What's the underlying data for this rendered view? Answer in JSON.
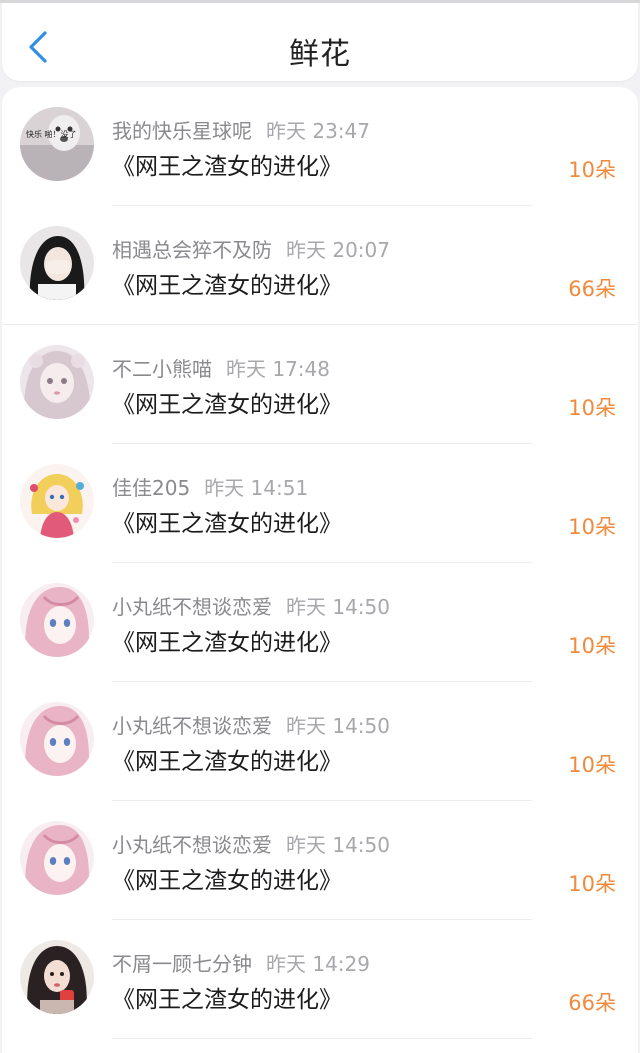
{
  "header": {
    "title": "鲜花",
    "back_icon": "chevron-left-icon",
    "back_color": "#2f8fe6"
  },
  "accent_color": "#f08a3c",
  "items": [
    {
      "user": "我的快乐星球呢",
      "time": "昨天 23:47",
      "book": "《网王之渣女的进化》",
      "amount": "10朵",
      "avatar_text": "快乐 啪！没了"
    },
    {
      "user": "相遇总会猝不及防",
      "time": "昨天 20:07",
      "book": "《网王之渣女的进化》",
      "amount": "66朵"
    },
    {
      "user": "不二小熊喵",
      "time": "昨天 17:48",
      "book": "《网王之渣女的进化》",
      "amount": "10朵"
    },
    {
      "user": "佳佳205",
      "time": "昨天 14:51",
      "book": "《网王之渣女的进化》",
      "amount": "10朵"
    },
    {
      "user": "小丸纸不想谈恋爱",
      "time": "昨天 14:50",
      "book": "《网王之渣女的进化》",
      "amount": "10朵"
    },
    {
      "user": "小丸纸不想谈恋爱",
      "time": "昨天 14:50",
      "book": "《网王之渣女的进化》",
      "amount": "10朵"
    },
    {
      "user": "小丸纸不想谈恋爱",
      "time": "昨天 14:50",
      "book": "《网王之渣女的进化》",
      "amount": "10朵"
    },
    {
      "user": "不屑一顾七分钟",
      "time": "昨天 14:29",
      "book": "《网王之渣女的进化》",
      "amount": "66朵"
    }
  ]
}
